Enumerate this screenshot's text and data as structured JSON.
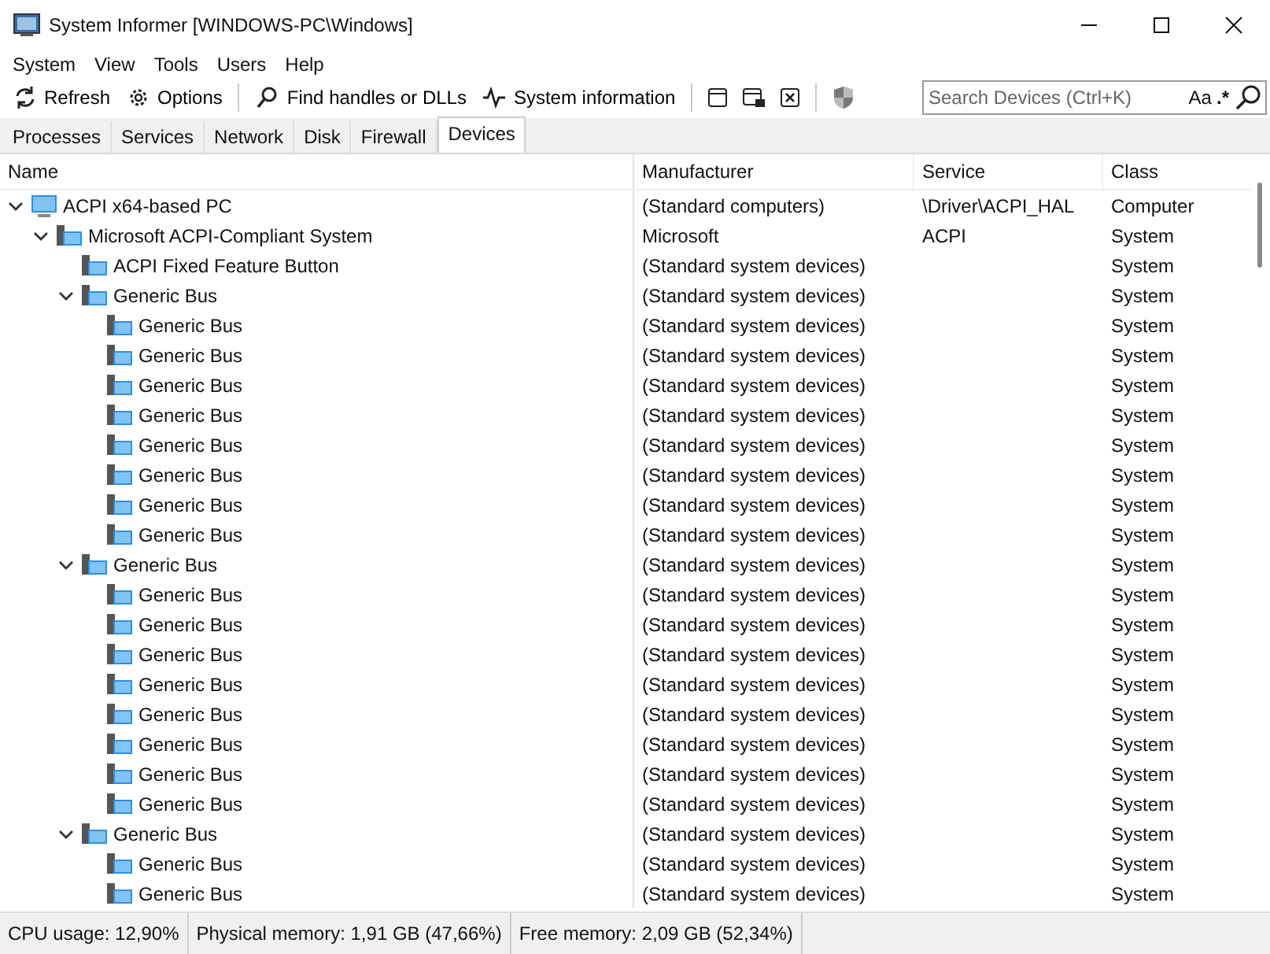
{
  "window": {
    "title": "System Informer [WINDOWS-PC\\Windows]"
  },
  "menu": [
    "System",
    "View",
    "Tools",
    "Users",
    "Help"
  ],
  "toolbar": {
    "buttons": [
      {
        "kind": "refresh",
        "label": "Refresh"
      },
      {
        "kind": "gear",
        "label": "Options"
      },
      {
        "kind": "search",
        "label": "Find handles or DLLs"
      },
      {
        "kind": "pulse",
        "label": "System information"
      }
    ],
    "search": {
      "placeholder": "Search Devices (Ctrl+K)",
      "case_toggle": "Aa",
      "regex_toggle": ".*"
    }
  },
  "tabs": [
    {
      "label": "Processes",
      "selected": false
    },
    {
      "label": "Services",
      "selected": false
    },
    {
      "label": "Network",
      "selected": false
    },
    {
      "label": "Disk",
      "selected": false
    },
    {
      "label": "Firewall",
      "selected": false
    },
    {
      "label": "Devices",
      "selected": true
    }
  ],
  "table": {
    "columns": [
      "Name",
      "Manufacturer",
      "Service",
      "Class"
    ],
    "rows": [
      {
        "kind": "computer",
        "name": "ACPI x64-based PC",
        "manufacturer": "(Standard computers)",
        "service": "\\Driver\\ACPI_HAL",
        "class": "Computer",
        "expanded": true,
        "children": [
          {
            "kind": "device",
            "name": "Microsoft ACPI-Compliant System",
            "manufacturer": "Microsoft",
            "service": "ACPI",
            "class": "System",
            "expanded": true,
            "children": [
              {
                "kind": "device",
                "name": "ACPI Fixed Feature Button",
                "manufacturer": "(Standard system devices)",
                "class": "System"
              },
              {
                "kind": "device",
                "name": "Generic Bus",
                "manufacturer": "(Standard system devices)",
                "class": "System",
                "expanded": true,
                "children": [
                  {
                    "kind": "device",
                    "name": "Generic Bus",
                    "manufacturer": "(Standard system devices)",
                    "class": "System"
                  },
                  {
                    "kind": "device",
                    "name": "Generic Bus",
                    "manufacturer": "(Standard system devices)",
                    "class": "System"
                  },
                  {
                    "kind": "device",
                    "name": "Generic Bus",
                    "manufacturer": "(Standard system devices)",
                    "class": "System"
                  },
                  {
                    "kind": "device",
                    "name": "Generic Bus",
                    "manufacturer": "(Standard system devices)",
                    "class": "System"
                  },
                  {
                    "kind": "device",
                    "name": "Generic Bus",
                    "manufacturer": "(Standard system devices)",
                    "class": "System"
                  },
                  {
                    "kind": "device",
                    "name": "Generic Bus",
                    "manufacturer": "(Standard system devices)",
                    "class": "System"
                  },
                  {
                    "kind": "device",
                    "name": "Generic Bus",
                    "manufacturer": "(Standard system devices)",
                    "class": "System"
                  },
                  {
                    "kind": "device",
                    "name": "Generic Bus",
                    "manufacturer": "(Standard system devices)",
                    "class": "System"
                  }
                ]
              },
              {
                "kind": "device",
                "name": "Generic Bus",
                "manufacturer": "(Standard system devices)",
                "class": "System",
                "expanded": true,
                "children": [
                  {
                    "kind": "device",
                    "name": "Generic Bus",
                    "manufacturer": "(Standard system devices)",
                    "class": "System"
                  },
                  {
                    "kind": "device",
                    "name": "Generic Bus",
                    "manufacturer": "(Standard system devices)",
                    "class": "System"
                  },
                  {
                    "kind": "device",
                    "name": "Generic Bus",
                    "manufacturer": "(Standard system devices)",
                    "class": "System"
                  },
                  {
                    "kind": "device",
                    "name": "Generic Bus",
                    "manufacturer": "(Standard system devices)",
                    "class": "System"
                  },
                  {
                    "kind": "device",
                    "name": "Generic Bus",
                    "manufacturer": "(Standard system devices)",
                    "class": "System"
                  },
                  {
                    "kind": "device",
                    "name": "Generic Bus",
                    "manufacturer": "(Standard system devices)",
                    "class": "System"
                  },
                  {
                    "kind": "device",
                    "name": "Generic Bus",
                    "manufacturer": "(Standard system devices)",
                    "class": "System"
                  },
                  {
                    "kind": "device",
                    "name": "Generic Bus",
                    "manufacturer": "(Standard system devices)",
                    "class": "System"
                  }
                ]
              },
              {
                "kind": "device",
                "name": "Generic Bus",
                "manufacturer": "(Standard system devices)",
                "class": "System",
                "expanded": true,
                "children": [
                  {
                    "kind": "device",
                    "name": "Generic Bus",
                    "manufacturer": "(Standard system devices)",
                    "class": "System"
                  },
                  {
                    "kind": "device",
                    "name": "Generic Bus",
                    "manufacturer": "(Standard system devices)",
                    "class": "System"
                  }
                ]
              }
            ]
          }
        ]
      }
    ]
  },
  "status_bar": [
    "CPU usage: 12,90%",
    "Physical memory: 1,91 GB (47,66%)",
    "Free memory: 2,09 GB (52,34%)"
  ]
}
